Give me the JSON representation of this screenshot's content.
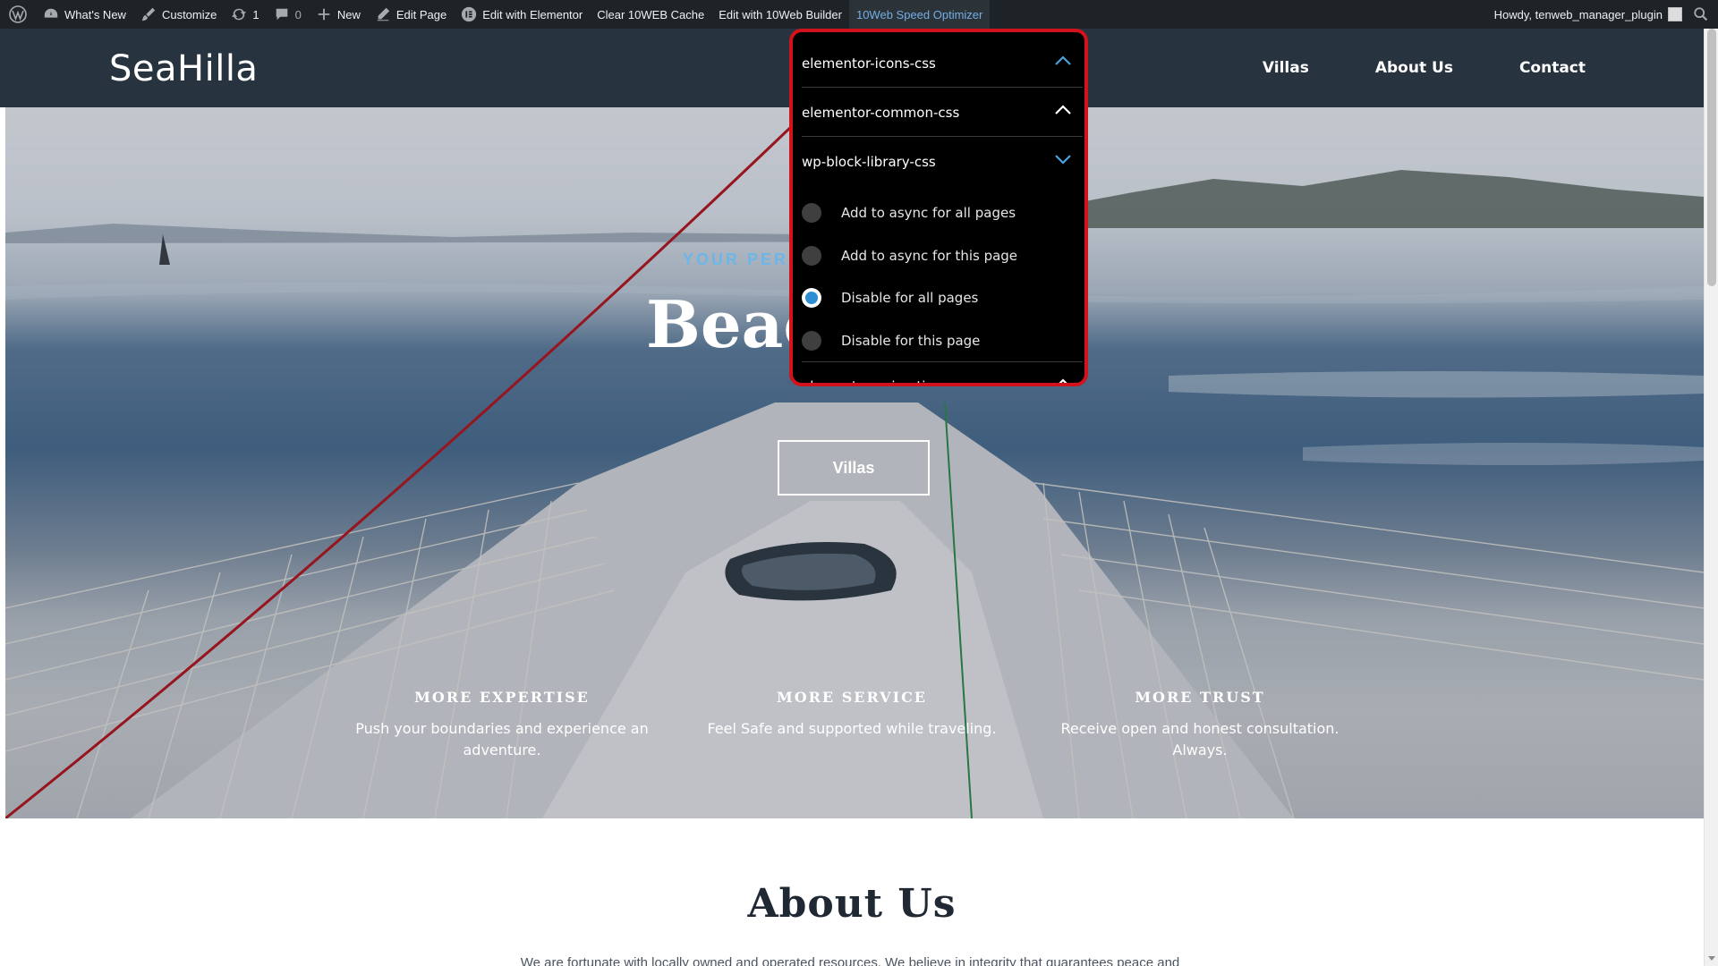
{
  "adminbar": {
    "items": [
      {
        "label": "What's New",
        "icon": "dashboard-icon"
      },
      {
        "label": "Customize",
        "icon": "brush-icon"
      },
      {
        "label": "1",
        "icon": "updates-icon"
      },
      {
        "label": "0",
        "icon": "comment-icon"
      },
      {
        "label": "New",
        "icon": "plus-icon"
      },
      {
        "label": "Edit Page",
        "icon": "pencil-icon"
      },
      {
        "label": "Edit with Elementor",
        "icon": "elementor-icon"
      },
      {
        "label": "Clear 10WEB Cache"
      },
      {
        "label": "Edit with 10Web Builder"
      },
      {
        "label": "10Web Speed Optimizer"
      }
    ],
    "user_greeting": "Howdy, tenweb_manager_plugin"
  },
  "site": {
    "logo": "SeaHilla",
    "nav": [
      "Villas",
      "About Us",
      "Contact"
    ]
  },
  "hero": {
    "eyebrow": "YOUR PERF",
    "title": "Beac",
    "button": "Villas",
    "features": [
      {
        "title": "MORE EXPERTISE",
        "text": "Push your boundaries and experience an adventure."
      },
      {
        "title": "MORE SERVICE",
        "text": "Feel Safe and supported while traveling."
      },
      {
        "title": "MORE TRUST",
        "text": "Receive open and honest consultation. Always."
      }
    ]
  },
  "about": {
    "title": "About Us",
    "text": "We are fortunate with locally owned and operated resources. We believe in integrity that guarantees peace and"
  },
  "optimizer": {
    "rows": [
      {
        "label": "elementor-icons-css",
        "state": "collapsed"
      },
      {
        "label": "elementor-common-css",
        "state": "collapsed"
      },
      {
        "label": "wp-block-library-css",
        "state": "expanded"
      },
      {
        "label": "elementor-animations-css",
        "state": "collapsed"
      }
    ],
    "options": [
      {
        "label": "Add to async for all pages",
        "checked": false
      },
      {
        "label": "Add to async for this page",
        "checked": false
      },
      {
        "label": "Disable for all pages",
        "checked": true
      },
      {
        "label": "Disable for this page",
        "checked": false
      }
    ]
  },
  "colors": {
    "adminbar_bg": "#1d2327",
    "header_bg": "#27333f",
    "panel_border": "#d3131b",
    "accent_blue": "#2d8ed3"
  }
}
